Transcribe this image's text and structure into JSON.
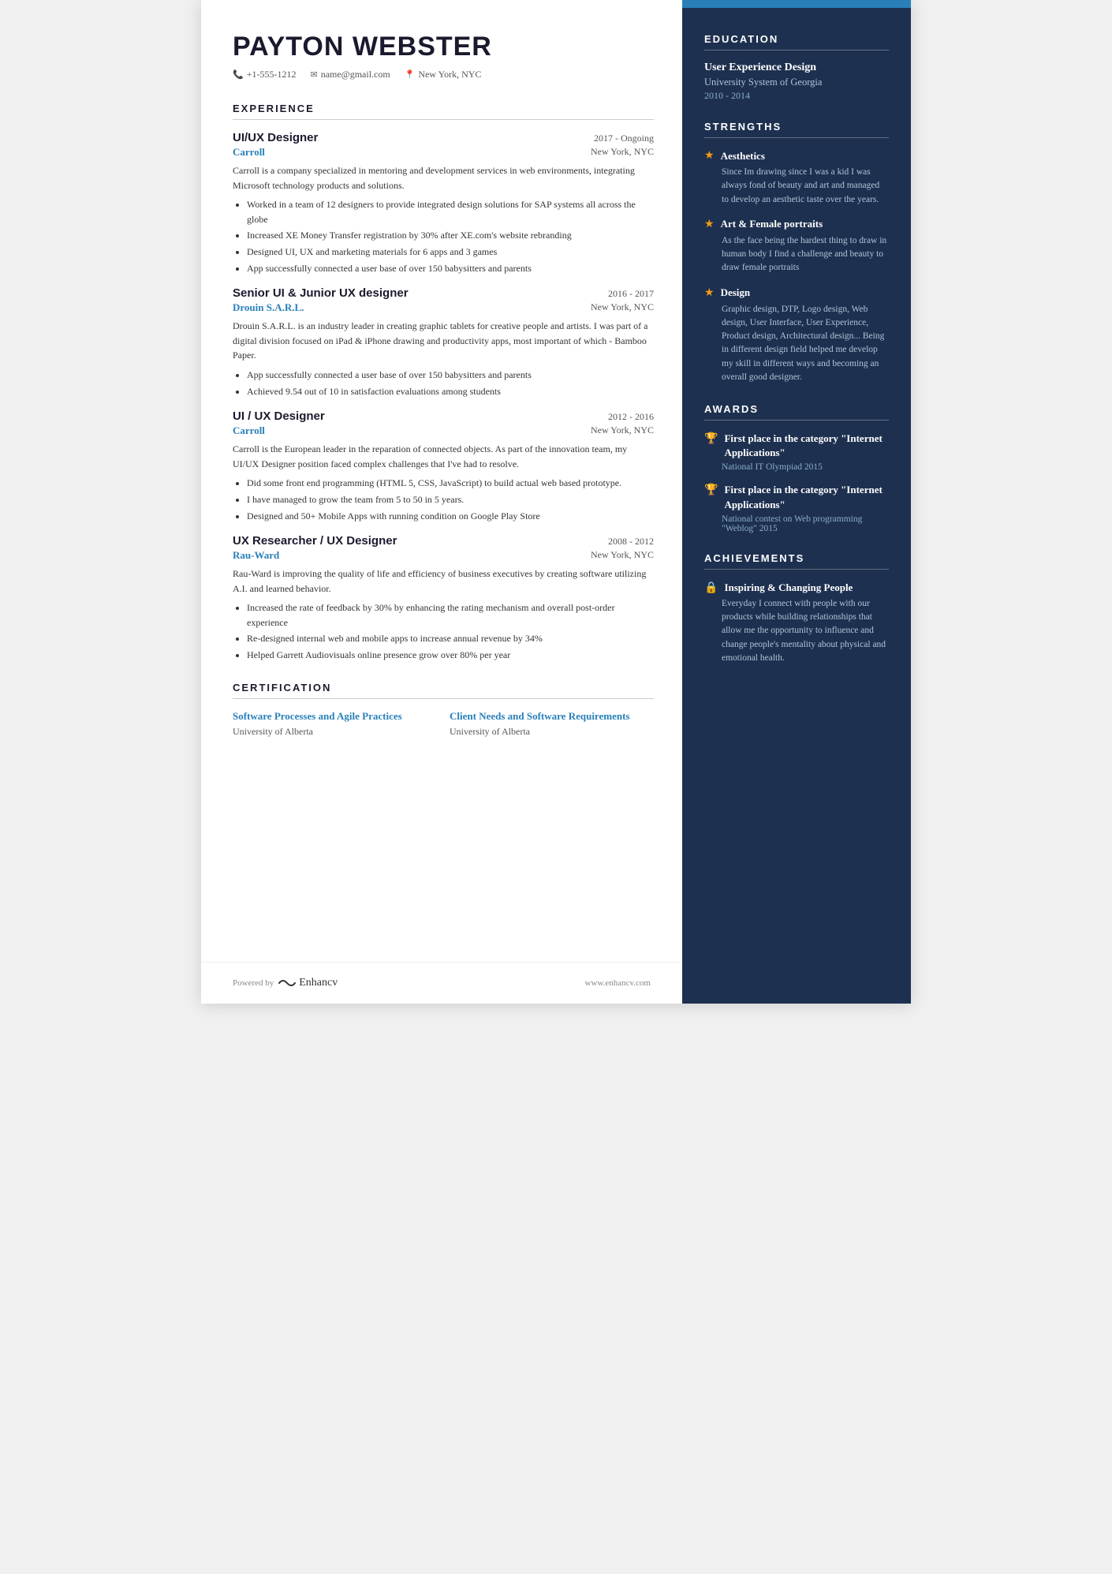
{
  "header": {
    "name": "PAYTON WEBSTER",
    "phone": "+1-555-1212",
    "email": "name@gmail.com",
    "location": "New York, NYC"
  },
  "experience_section": {
    "title": "EXPERIENCE",
    "jobs": [
      {
        "title": "UI/UX Designer",
        "dates": "2017 - Ongoing",
        "company": "Carroll",
        "location": "New York, NYC",
        "desc": "Carroll is a company specialized in mentoring and development services in web environments, integrating Microsoft technology products and solutions.",
        "bullets": [
          "Worked in a team of 12 designers to provide integrated design solutions for SAP systems all across the globe",
          "Increased XE Money Transfer registration by 30% after XE.com's website rebranding",
          "Designed UI, UX and marketing materials for 6 apps and 3 games",
          "App successfully connected a user base of over 150 babysitters and parents"
        ]
      },
      {
        "title": "Senior UI & Junior UX designer",
        "dates": "2016 - 2017",
        "company": "Drouin S.A.R.L.",
        "location": "New York, NYC",
        "desc": "Drouin S.A.R.L. is an industry leader in creating graphic tablets for creative people and artists. I was part of a digital division focused on iPad & iPhone drawing and productivity apps, most important of which - Bamboo Paper.",
        "bullets": [
          "App successfully connected a user base of over 150 babysitters and parents",
          "Achieved 9.54 out of 10 in satisfaction evaluations among students"
        ]
      },
      {
        "title": "UI / UX Designer",
        "dates": "2012 - 2016",
        "company": "Carroll",
        "location": "New York, NYC",
        "desc": "Carroll is the European leader in the reparation of connected objects. As part of the innovation team, my UI/UX Designer position faced complex challenges that I've had to resolve.",
        "bullets": [
          "Did some front end programming (HTML 5, CSS, JavaScript) to build actual web based prototype.",
          "I have managed to grow the team from 5 to 50 in 5 years.",
          "Designed and 50+ Mobile Apps with running condition on Google Play Store"
        ]
      },
      {
        "title": "UX Researcher / UX Designer",
        "dates": "2008 - 2012",
        "company": "Rau-Ward",
        "location": "New York, NYC",
        "desc": "Rau-Ward is improving the quality of life and efficiency of business executives by creating software utilizing A.I. and learned behavior.",
        "bullets": [
          "Increased the rate of feedback by 30% by enhancing the rating mechanism and overall post-order experience",
          "Re-designed internal web and mobile apps to increase annual revenue by 34%",
          "Helped Garrett Audiovisuals online presence grow over 80% per year"
        ]
      }
    ]
  },
  "certification_section": {
    "title": "CERTIFICATION",
    "items": [
      {
        "title": "Software Processes and Agile Practices",
        "school": "University of Alberta"
      },
      {
        "title": "Client Needs and Software Requirements",
        "school": "University of Alberta"
      }
    ]
  },
  "footer": {
    "powered_by": "Powered by",
    "brand": "Enhancv",
    "website": "www.enhancv.com"
  },
  "education_section": {
    "title": "EDUCATION",
    "degree": "User Experience Design",
    "school": "University System of Georgia",
    "years": "2010 - 2014"
  },
  "strengths_section": {
    "title": "STRENGTHS",
    "items": [
      {
        "title": "Aesthetics",
        "desc": "Since Im drawing since I was a kid I was always fond of beauty and art and managed to develop an aesthetic taste over the years."
      },
      {
        "title": "Art & Female portraits",
        "desc": "As the face being the hardest thing to draw in human body I find a challenge and beauty to draw female portraits"
      },
      {
        "title": "Design",
        "desc": "Graphic design, DTP, Logo design, Web design, User Interface, User Experience, Product design, Architectural design... Being in different design field helped me develop my skill in different ways and becoming an overall good designer."
      }
    ]
  },
  "awards_section": {
    "title": "AWARDS",
    "items": [
      {
        "title": "First place in the category \"Internet Applications\"",
        "sub": "National IT Olympiad 2015"
      },
      {
        "title": "First place in the category \"Internet Applications\"",
        "sub": "National contest on Web programming \"Weblog\" 2015"
      }
    ]
  },
  "achievements_section": {
    "title": "ACHIEVEMENTS",
    "items": [
      {
        "title": "Inspiring & Changing People",
        "desc": "Everyday I connect with people with our products while building relationships that allow me the opportunity to influence and change people's mentality about physical and emotional health."
      }
    ]
  }
}
